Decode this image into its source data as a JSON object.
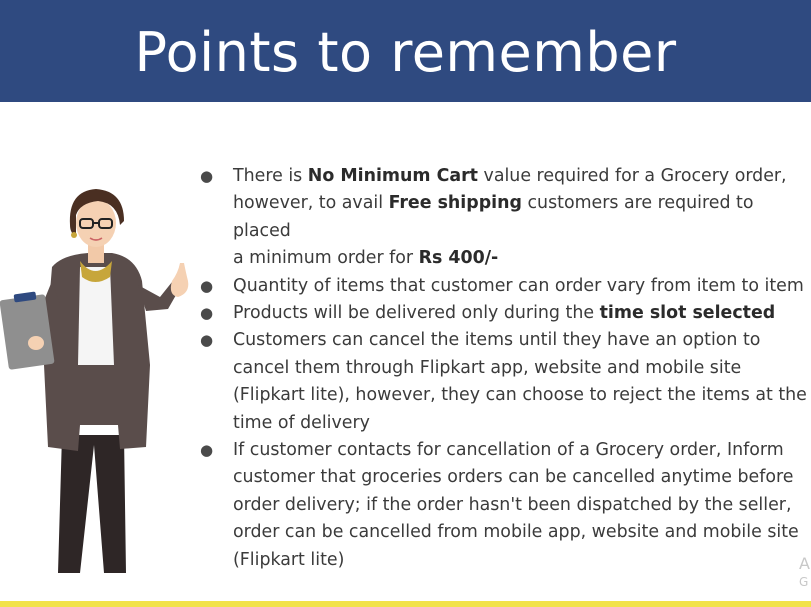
{
  "slide": {
    "title": "Points to remember",
    "corner_text_line1": "A",
    "corner_text_line2": "G"
  },
  "points": [
    {
      "parts": [
        {
          "text": "There is ",
          "bold": false
        },
        {
          "text": "No Minimum Cart",
          "bold": true
        },
        {
          "text": " value required for a Grocery order,",
          "bold": false
        },
        {
          "text": "however, to avail ",
          "bold": false,
          "newline": true
        },
        {
          "text": "Free shipping",
          "bold": true
        },
        {
          "text": " customers are required to placed",
          "bold": false
        },
        {
          "text": "a minimum order for ",
          "bold": false,
          "newline": true
        },
        {
          "text": "Rs 400/-",
          "bold": true
        }
      ]
    },
    {
      "parts": [
        {
          "text": "Quantity of items that customer can order vary from item to item",
          "bold": false
        }
      ]
    },
    {
      "parts": [
        {
          "text": "Products will be delivered only during the ",
          "bold": false
        },
        {
          "text": "time slot selected",
          "bold": true
        }
      ]
    },
    {
      "parts": [
        {
          "text": "Customers can cancel the items until they have an option to",
          "bold": false
        },
        {
          "text": "cancel them through Flipkart app, website and mobile site",
          "bold": false,
          "newline": true
        },
        {
          "text": "(Flipkart lite), however, they can choose to reject the items at the",
          "bold": false,
          "newline": true
        },
        {
          "text": "time of delivery",
          "bold": false,
          "newline": true
        }
      ]
    },
    {
      "parts": [
        {
          "text": "If customer contacts for cancellation of a Grocery order, Inform",
          "bold": false
        },
        {
          "text": "customer that groceries orders can be cancelled anytime before",
          "bold": false,
          "newline": true
        },
        {
          "text": "order delivery; if the order hasn't been dispatched by the seller,",
          "bold": false,
          "newline": true
        },
        {
          "text": "order can be cancelled from mobile app, website and mobile site",
          "bold": false,
          "newline": true
        },
        {
          "text": "(Flipkart lite)",
          "bold": false,
          "newline": true
        }
      ]
    }
  ],
  "colors": {
    "title_bar": "#2f4a80",
    "body_text": "#3b3b3b",
    "bottom_line": "#f2e24a",
    "jacket": "#5a4d4b",
    "hair": "#4a2f22",
    "clipboard": "#8f8f8f"
  },
  "icons": {
    "bullet": "●"
  }
}
